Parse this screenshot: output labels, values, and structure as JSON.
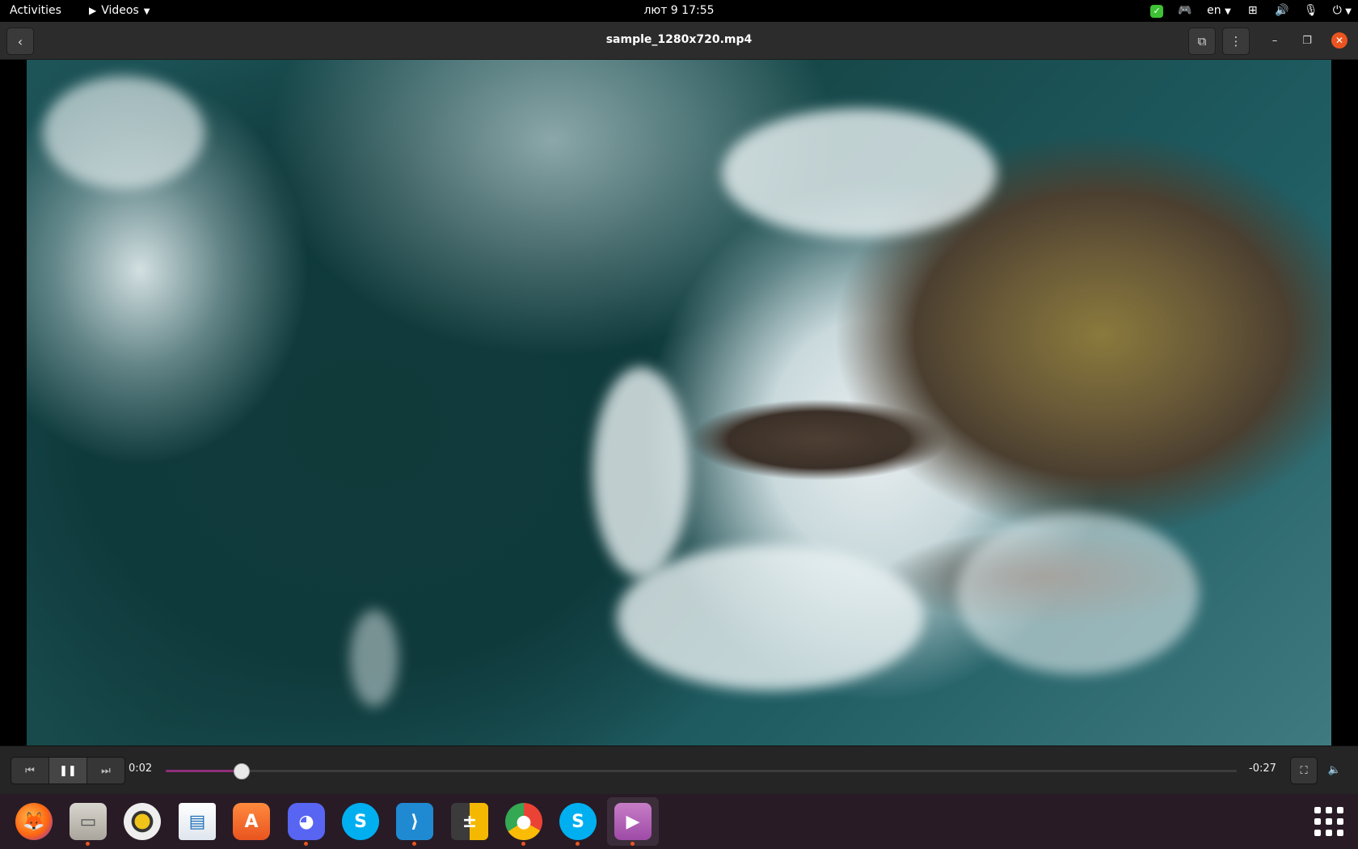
{
  "topbar": {
    "activities": "Activities",
    "app_menu": "Videos",
    "clock": "лют 9  17:55",
    "language": "en"
  },
  "headerbar": {
    "title": "sample_1280x720.mp4"
  },
  "controls": {
    "elapsed": "0:02",
    "remaining": "-0:27",
    "progress_fraction": 0.07
  },
  "dock": {
    "items": [
      {
        "name": "Firefox",
        "icon": "firefox-icon",
        "running": false
      },
      {
        "name": "Files",
        "icon": "files-icon",
        "running": true
      },
      {
        "name": "Rhythmbox",
        "icon": "rhythmbox-icon",
        "running": false
      },
      {
        "name": "LibreOffice Writer",
        "icon": "writer-icon",
        "running": false
      },
      {
        "name": "Ubuntu Software",
        "icon": "software-icon",
        "running": false
      },
      {
        "name": "Discord",
        "icon": "discord-icon",
        "running": true
      },
      {
        "name": "Skype",
        "icon": "skype-icon",
        "running": false
      },
      {
        "name": "Visual Studio Code",
        "icon": "vscode-icon",
        "running": true
      },
      {
        "name": "Calculator",
        "icon": "calculator-icon",
        "running": false
      },
      {
        "name": "Chrome",
        "icon": "chrome-icon",
        "running": true
      },
      {
        "name": "Skype",
        "icon": "skype-icon",
        "running": true
      },
      {
        "name": "Videos",
        "icon": "videos-icon",
        "running": true,
        "active": true
      }
    ]
  },
  "colors": {
    "accent": "#e95420",
    "seek_fill": "#8e2e7a",
    "dock_bg": "#281b26"
  }
}
